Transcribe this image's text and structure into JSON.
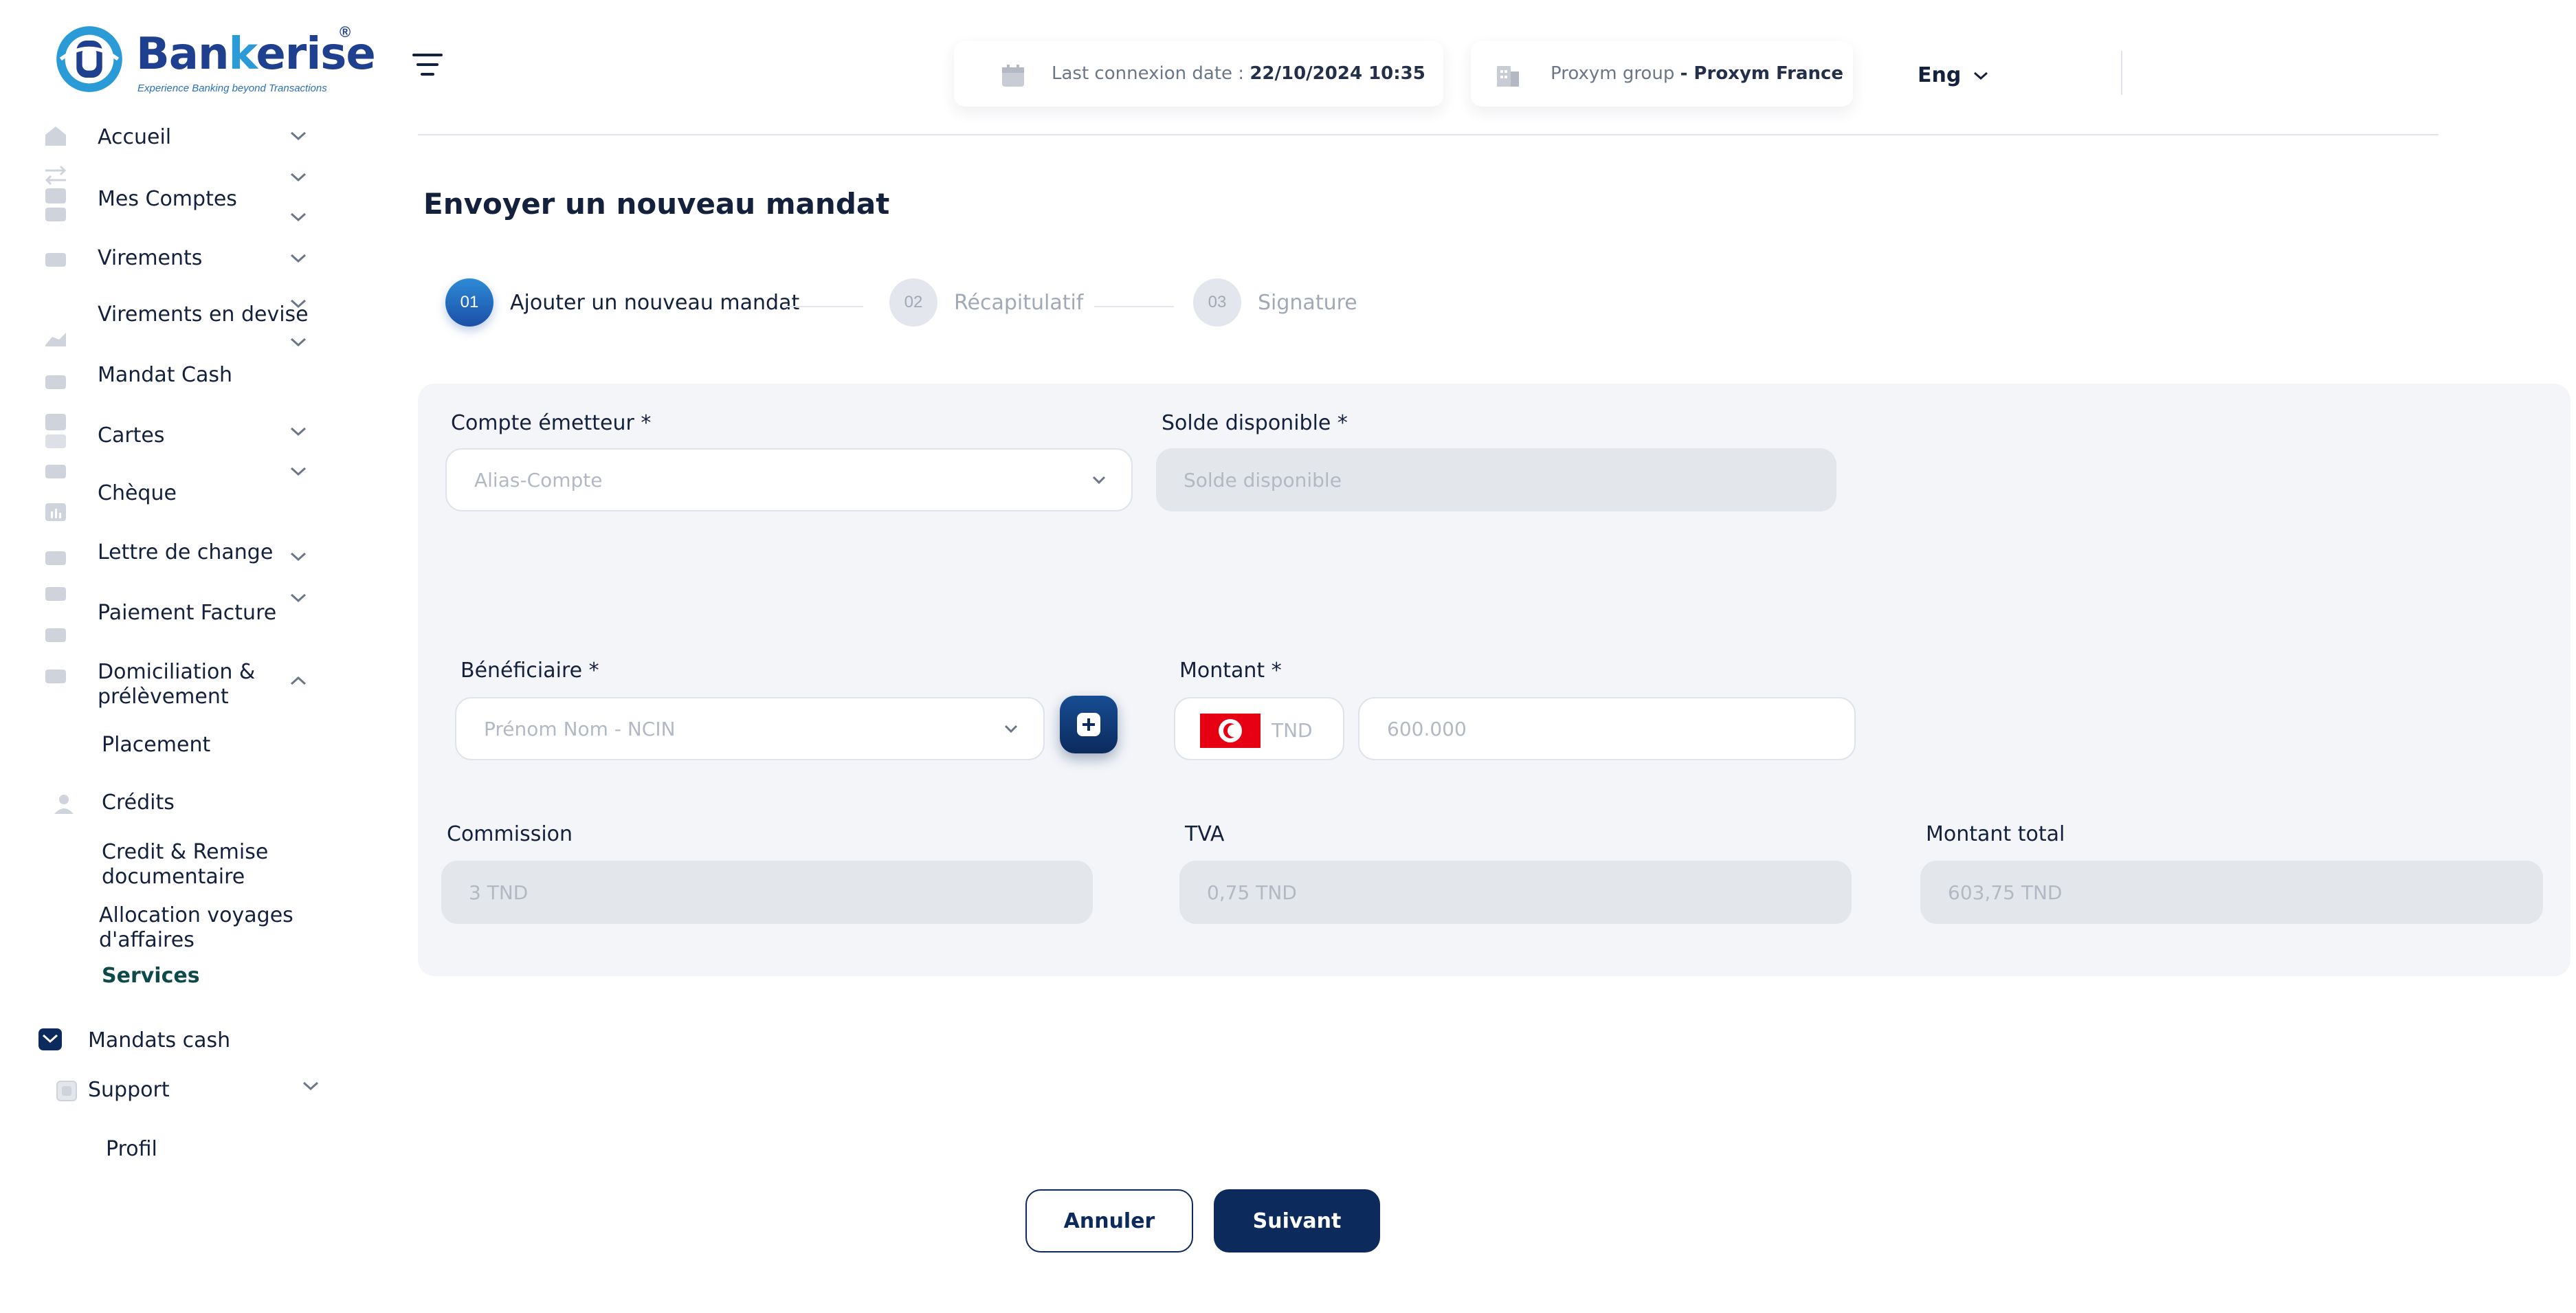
{
  "logo": {
    "name_a": "Ban",
    "name_b": "k",
    "name_c": "erise",
    "reg": "®",
    "tagline": "Experience Banking beyond Transactions"
  },
  "sidebar": {
    "items": [
      {
        "label": "Accueil",
        "icon": "home-icon",
        "has_chevron": true
      },
      {
        "label": "Mes Comptes",
        "icon": "wallet-icon",
        "has_chevron": true
      },
      {
        "label": "Virements",
        "icon": "transfer-icon",
        "has_chevron": true
      },
      {
        "label": "Virements en devise",
        "icon": "exchange-icon",
        "has_chevron": true
      },
      {
        "label": "Mandat Cash",
        "icon": "hand-cash-icon",
        "has_chevron": false
      },
      {
        "label": "Cartes",
        "icon": "card-icon",
        "has_chevron": true
      },
      {
        "label": "Chèque",
        "icon": "cheque-icon",
        "has_chevron": true
      },
      {
        "label": "Lettre de change",
        "icon": "letter-icon",
        "has_chevron": true
      },
      {
        "label": "Paiement Facture",
        "icon": "invoice-icon",
        "has_chevron": true
      },
      {
        "label_line1": "Domiciliation &",
        "label_line2": "prélèvement",
        "icon": "mail-icon",
        "has_chevron": true,
        "expanded": true
      },
      {
        "label": "Placement"
      },
      {
        "label": "Crédits",
        "icon": "user-icon"
      },
      {
        "label_line1": "Credit & Remise",
        "label_line2": "documentaire"
      },
      {
        "label_line1": "Allocation  voyages",
        "label_line2": "d'affaires"
      },
      {
        "label": "Services",
        "active": true
      },
      {
        "label": "Mandats cash",
        "icon": "envelope-icon"
      },
      {
        "label": "Support",
        "icon": "support-icon",
        "has_chevron": true
      },
      {
        "label": "Profil"
      }
    ]
  },
  "header": {
    "last_connexion_label": "Last connexion date :",
    "last_connexion_value": "22/10/2024 10:35",
    "group_label": "Proxym group",
    "group_value": "- Proxym France",
    "language": "Eng"
  },
  "main": {
    "title": "Envoyer un nouveau mandat",
    "steps": [
      {
        "num": "01",
        "label": "Ajouter un nouveau mandat",
        "active": true
      },
      {
        "num": "02",
        "label": "Récapitulatif",
        "active": false
      },
      {
        "num": "03",
        "label": "Signature",
        "active": false
      }
    ],
    "form": {
      "compte_label": "Compte émetteur *",
      "compte_placeholder": "Alias-Compte",
      "solde_label": "Solde disponible *",
      "solde_placeholder": "Solde disponible",
      "beneficiaire_label": "Bénéficiaire *",
      "beneficiaire_placeholder": "Prénom Nom - NCIN",
      "montant_label": "Montant *",
      "currency": "TND",
      "montant_placeholder": "600.000",
      "commission_label": "Commission",
      "commission_value": "3 TND",
      "tva_label": "TVA",
      "tva_value": "0,75 TND",
      "total_label": "Montant total",
      "total_value": "603,75 TND"
    },
    "actions": {
      "cancel": "Annuler",
      "next": "Suivant"
    }
  },
  "colors": {
    "primary": "#0c2a5c",
    "accent": "#2a9bd6",
    "flag_red": "#e70013",
    "panel": "#f3f5f8"
  }
}
